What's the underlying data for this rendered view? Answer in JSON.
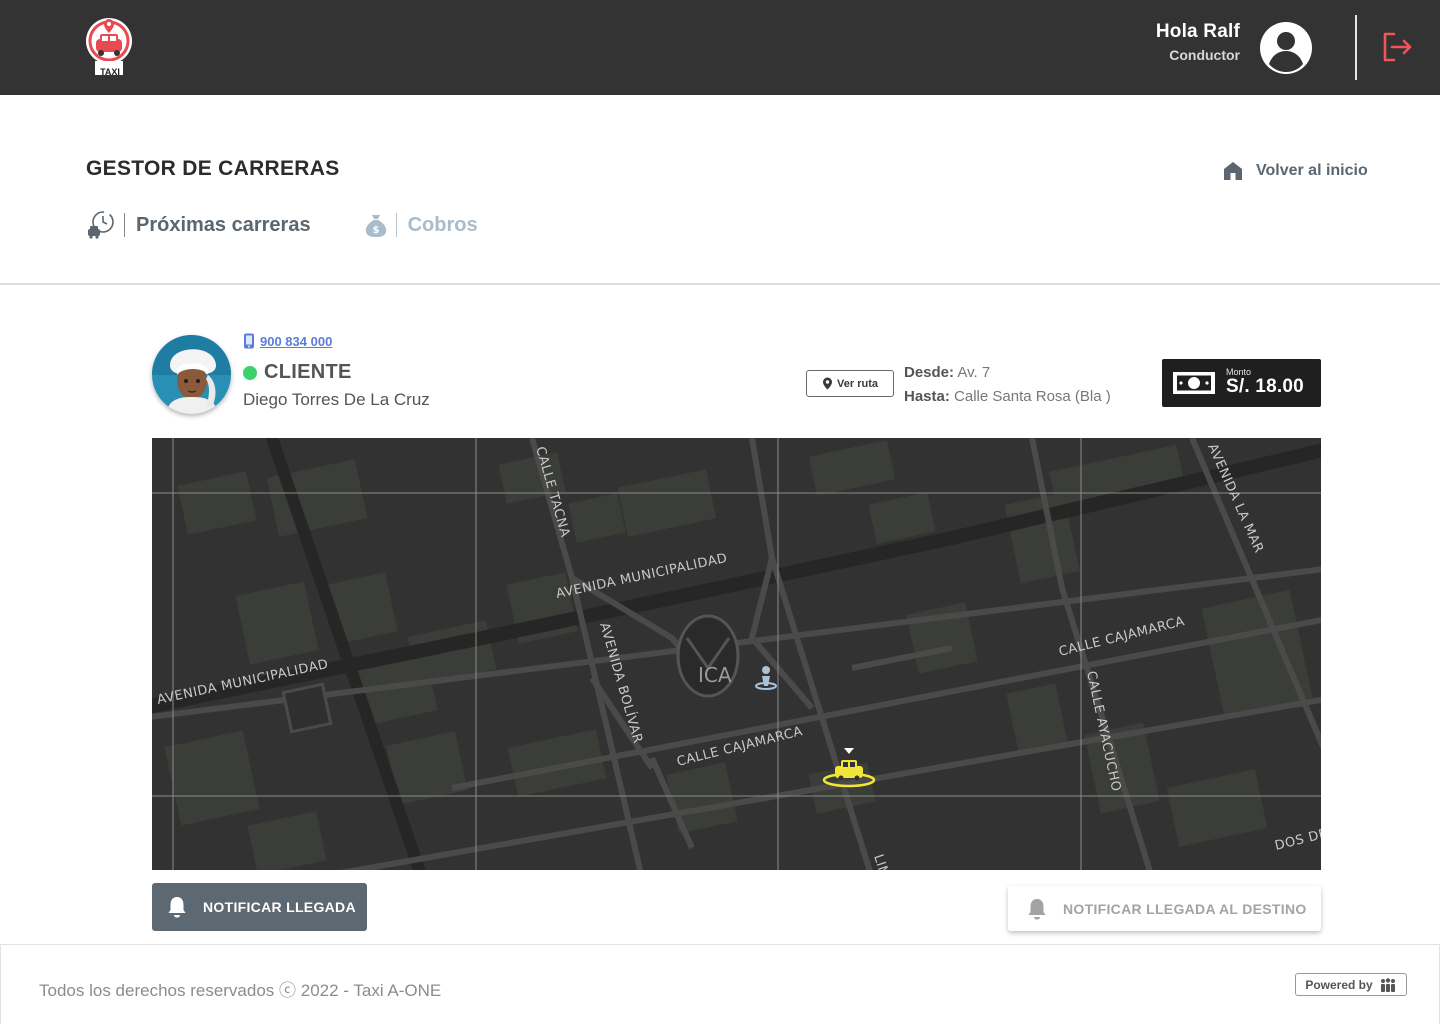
{
  "header": {
    "logo_text": "TAXI",
    "greeting": "Hola Ralf",
    "role": "Conductor",
    "logout_icon": "logout-icon",
    "accent_color": "#f0555a",
    "background": "#333333"
  },
  "page": {
    "title": "GESTOR DE CARRERAS",
    "back_home": "Volver al inicio"
  },
  "tabs": [
    {
      "label": "Próximas carreras",
      "icon": "clock-taxi-icon",
      "active": true
    },
    {
      "label": "Cobros",
      "icon": "money-bag-icon",
      "active": false
    }
  ],
  "client": {
    "phone": "900 834 000",
    "status_label": "CLIENTE",
    "status_color": "#3bd26b",
    "name": "Diego Torres De La Cruz"
  },
  "route": {
    "button_label": "Ver ruta",
    "from_label": "Desde:",
    "from_value": "Av. 7",
    "to_label": "Hasta:",
    "to_value": "Calle Santa Rosa (Bla )"
  },
  "payment": {
    "caption": "Monto",
    "amount": "S/. 18.00"
  },
  "map": {
    "streets": [
      "AVENIDA MUNICIPALIDAD",
      "AVENIDA MUNICIPALIDAD",
      "CALLE TACNA",
      "AVENIDA BOLÍVAR",
      "CALLE CAJAMARCA",
      "CALLE CAJAMARCA",
      "CALLE AYACUCHO",
      "AVENIDA LA MAR",
      "DOS DE",
      "LIM"
    ],
    "city_label": "ICA"
  },
  "actions": {
    "notify_arrival": "NOTIFICAR LLEGADA",
    "notify_destination": "NOTIFICAR LLEGADA AL DESTINO"
  },
  "footer": {
    "copyright": "Todos los derechos reservados ⓒ 2022  - Taxi A-ONE",
    "powered_by": "Powered by"
  }
}
